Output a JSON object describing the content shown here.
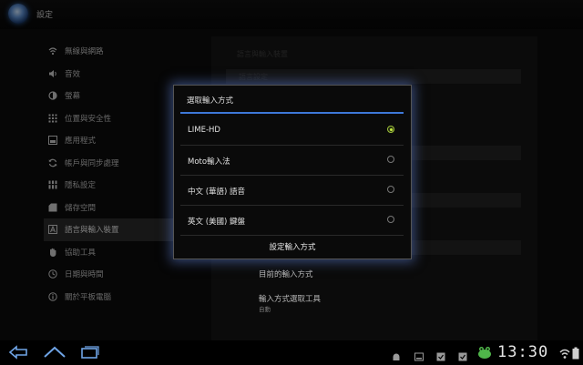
{
  "app": {
    "title": "設定"
  },
  "sidebar": {
    "items": [
      {
        "label": "無線與網路",
        "icon": "wifi-icon",
        "active": false
      },
      {
        "label": "音效",
        "icon": "speaker-icon",
        "active": false
      },
      {
        "label": "螢幕",
        "icon": "contrast-icon",
        "active": false
      },
      {
        "label": "位置與安全性",
        "icon": "location-grid-icon",
        "active": false
      },
      {
        "label": "應用程式",
        "icon": "apps-icon",
        "active": false
      },
      {
        "label": "帳戶與同步處理",
        "icon": "sync-icon",
        "active": false
      },
      {
        "label": "隱私設定",
        "icon": "privacy-icon",
        "active": false
      },
      {
        "label": "儲存空間",
        "icon": "storage-icon",
        "active": false
      },
      {
        "label": "語言與輸入裝置",
        "icon": "language-icon",
        "active": true
      },
      {
        "label": "協助工具",
        "icon": "hand-icon",
        "active": false
      },
      {
        "label": "日期與時間",
        "icon": "clock-icon",
        "active": false
      },
      {
        "label": "關於平板電腦",
        "icon": "info-icon",
        "active": false
      }
    ]
  },
  "content": {
    "header": "語言與輸入裝置",
    "section": "語言設定",
    "current_input_label": "目前的輸入方式",
    "selector_label": "輸入方式選取工具",
    "selector_value": "自動"
  },
  "dialog": {
    "title": "選取輸入方式",
    "options": [
      {
        "label": "LIME-HD",
        "selected": true
      },
      {
        "label": "Moto輸入法",
        "selected": false
      },
      {
        "label": "中文 (華語) 語音",
        "selected": false
      },
      {
        "label": "英文 (美國) 鍵盤",
        "selected": false
      }
    ],
    "footer": "設定輸入方式"
  },
  "status_bar": {
    "time": "13:30"
  }
}
